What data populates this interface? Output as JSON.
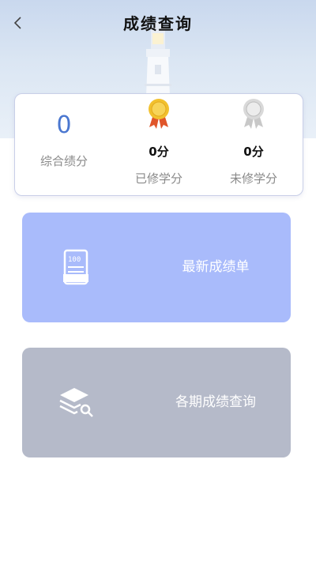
{
  "header": {
    "title": "成绩查询",
    "back_icon": "chevron-left-icon"
  },
  "summary": {
    "total_credit": {
      "value": "0",
      "label": "综合绩分"
    },
    "earned_credit": {
      "value": "0分",
      "label": "已修学分",
      "icon": "gold-medal-icon"
    },
    "remaining_credit": {
      "value": "0分",
      "label": "未修学分",
      "icon": "silver-medal-icon"
    }
  },
  "cards": {
    "latest": {
      "label": "最新成绩单",
      "icon": "report-sheet-icon",
      "color": "#a9bbfb"
    },
    "history": {
      "label": "各期成绩查询",
      "icon": "layers-search-icon",
      "color": "#b5bac9"
    }
  },
  "colors": {
    "accent": "#4a77d0",
    "gold": "#f2c12e",
    "ribbon": "#e0552a"
  }
}
